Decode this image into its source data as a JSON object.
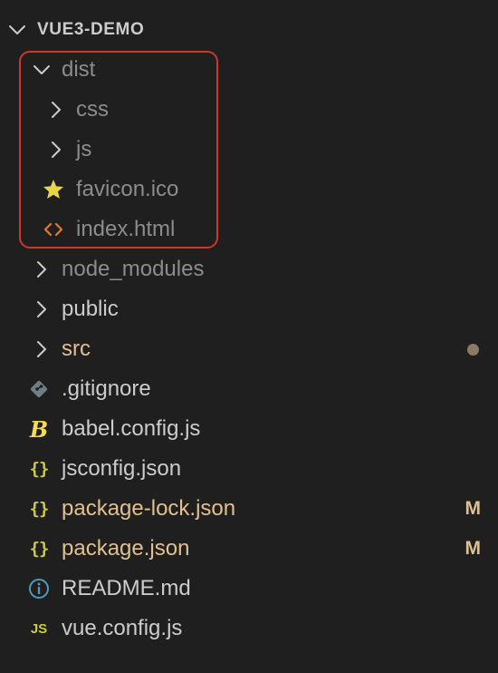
{
  "root": {
    "title": "VUE3-DEMO",
    "chevron_icon": "chevron-down-icon"
  },
  "colors": {
    "background": "#1f1f1f",
    "text": "#cccccc",
    "dimmed": "#8c8c8c",
    "modified": "#e2c08d",
    "modified_badge": "#e2c08d",
    "untracked_dot": "#8b7a64",
    "highlight_border": "#d0362f",
    "favicon_star": "#e8d44d",
    "html_icon": "#e37933",
    "json_icon": "#cbcb41",
    "info_icon": "#519aba",
    "gitignore_icon": "#6d8086"
  },
  "highlight": {
    "label": "dist-selection-highlight"
  },
  "tree": [
    {
      "name": "dist",
      "type": "folder",
      "expanded": true,
      "style": "dim",
      "icon": "chevron-down-icon"
    },
    {
      "name": "css",
      "type": "folder",
      "expanded": false,
      "style": "dim",
      "icon": "chevron-right-icon"
    },
    {
      "name": "js",
      "type": "folder",
      "expanded": false,
      "style": "dim",
      "icon": "chevron-right-icon"
    },
    {
      "name": "favicon.ico",
      "type": "file",
      "style": "dim",
      "icon": "star-icon"
    },
    {
      "name": "index.html",
      "type": "file",
      "style": "dim",
      "icon": "html-code-icon"
    },
    {
      "name": "node_modules",
      "type": "folder",
      "expanded": false,
      "style": "dim",
      "icon": "chevron-right-icon"
    },
    {
      "name": "public",
      "type": "folder",
      "expanded": false,
      "style": "default",
      "icon": "chevron-right-icon"
    },
    {
      "name": "src",
      "type": "folder",
      "expanded": false,
      "style": "modified",
      "icon": "chevron-right-icon",
      "status_dot": true
    },
    {
      "name": ".gitignore",
      "type": "file",
      "style": "default",
      "icon": "git-diamond-icon"
    },
    {
      "name": "babel.config.js",
      "type": "file",
      "style": "default",
      "icon": "babel-icon"
    },
    {
      "name": "jsconfig.json",
      "type": "file",
      "style": "default",
      "icon": "json-braces-icon",
      "glyph": "{}"
    },
    {
      "name": "package-lock.json",
      "type": "file",
      "style": "modified",
      "icon": "json-braces-icon",
      "glyph": "{}",
      "badge": "M"
    },
    {
      "name": "package.json",
      "type": "file",
      "style": "modified",
      "icon": "json-braces-icon",
      "glyph": "{}",
      "badge": "M"
    },
    {
      "name": "README.md",
      "type": "file",
      "style": "default",
      "icon": "info-icon"
    },
    {
      "name": "vue.config.js",
      "type": "file",
      "style": "default",
      "icon": "js-icon",
      "glyph": "JS"
    }
  ]
}
